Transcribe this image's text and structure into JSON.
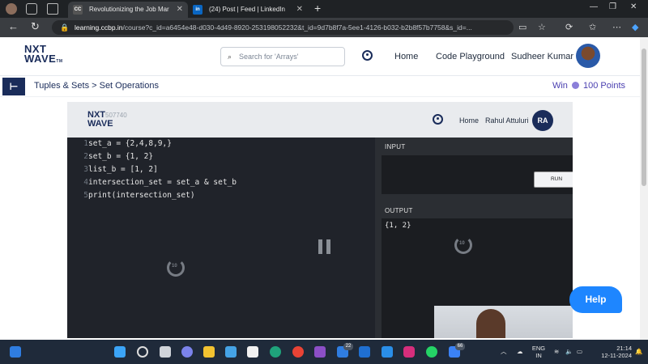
{
  "browser": {
    "tabs": [
      {
        "label": "Revolutionizing the Job Mar",
        "favicon": "ccbp-favicon"
      },
      {
        "label": "(24) Post | Feed | LinkedIn",
        "favicon": "linkedin-favicon"
      }
    ],
    "url_host": "learning.ccbp.in",
    "url_rest": "/course?c_id=a6454e48-d030-4d49-8920-253198052232&t_id=9d7b8f7a-5ee1-4126-b032-b2b8f57b7758&s_id=..."
  },
  "site": {
    "logo_top": "NXT",
    "logo_bottom": "WAVE",
    "logo_tm": "TM",
    "search_placeholder": "Search for 'Arrays'",
    "nav": {
      "home": "Home",
      "playground": "Code Playground",
      "user": "Sudheer Kumar"
    }
  },
  "breadcrumb": {
    "path": "Tuples & Sets > Set Operations",
    "reward_prefix": "Win",
    "reward_points": "100 Points"
  },
  "video": {
    "header": {
      "logo_top": "NXT",
      "logo_bottom": "WAVE",
      "logo_id": "507740",
      "home": "Home",
      "user": "Rahul Attuluri",
      "initials": "RA"
    },
    "code": [
      {
        "n": "1",
        "text": "set_a = {2,4,8,9,}"
      },
      {
        "n": "2",
        "text": "set_b = {1, 2}"
      },
      {
        "n": "3",
        "text": "list_b = [1, 2]"
      },
      {
        "n": "4",
        "text": "intersection_set = set_a & set_b"
      },
      {
        "n": "5",
        "text": "print(intersection_set)"
      }
    ],
    "input_label": "INPUT",
    "run_label": "RUN",
    "output_label": "OUTPUT",
    "output_value": "{1, 2}",
    "rewind_seconds": "10",
    "forward_seconds": "10"
  },
  "help_label": "Help",
  "taskbar": {
    "badge_a": "22",
    "badge_b": "66",
    "lang_top": "ENG",
    "lang_bottom": "IN",
    "time": "21:14",
    "date": "12-11-2024"
  }
}
